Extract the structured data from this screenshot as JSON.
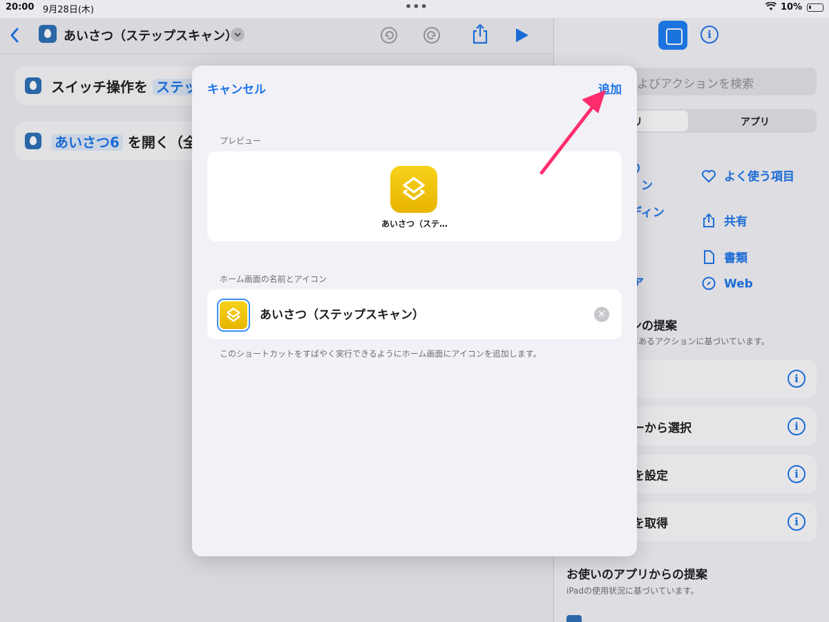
{
  "status_bar": {
    "time": "20:00",
    "date": "9月28日(木)",
    "battery": "10%"
  },
  "editor": {
    "title": "あいさつ（ステップスキャン）",
    "actions": [
      {
        "prefix": "スイッチ操作を",
        "token": "ステッ",
        "suffix": ""
      },
      {
        "prefix": "",
        "token": "あいさつ6",
        "suffix": "を開く（全"
      }
    ]
  },
  "right_pane": {
    "search_placeholder": "よびアクションを検索",
    "segments": [
      "リ",
      "アプリ"
    ],
    "left_fragments": [
      "り",
      "ン",
      "ディン",
      "ア"
    ],
    "categories": [
      "よく使う項目",
      "共有",
      "書類",
      "Web"
    ],
    "suggestions_heading": "ンの提案",
    "suggestions_sub": "にあるアクションに基づいています。",
    "suggestion_items": [
      "",
      "ーから選択",
      "を設定",
      "を取得"
    ],
    "app_heading": "お使いのアプリからの提案",
    "app_sub": "iPadの使用状況に基づいています。"
  },
  "modal": {
    "cancel_label": "キャンセル",
    "add_label": "追加",
    "preview_section": "プレビュー",
    "preview_app_label": "あいさつ（ステ…",
    "name_section": "ホーム画面の名前とアイコン",
    "name_value": "あいさつ（ステップスキャン）",
    "note": "このショートカットをすばやく実行できるようにホーム画面にアイコンを追加します。"
  },
  "colors": {
    "accent": "#1a73e8",
    "icon_yellow": "#f2c511",
    "annotation_arrow": "#ff2d6e"
  }
}
